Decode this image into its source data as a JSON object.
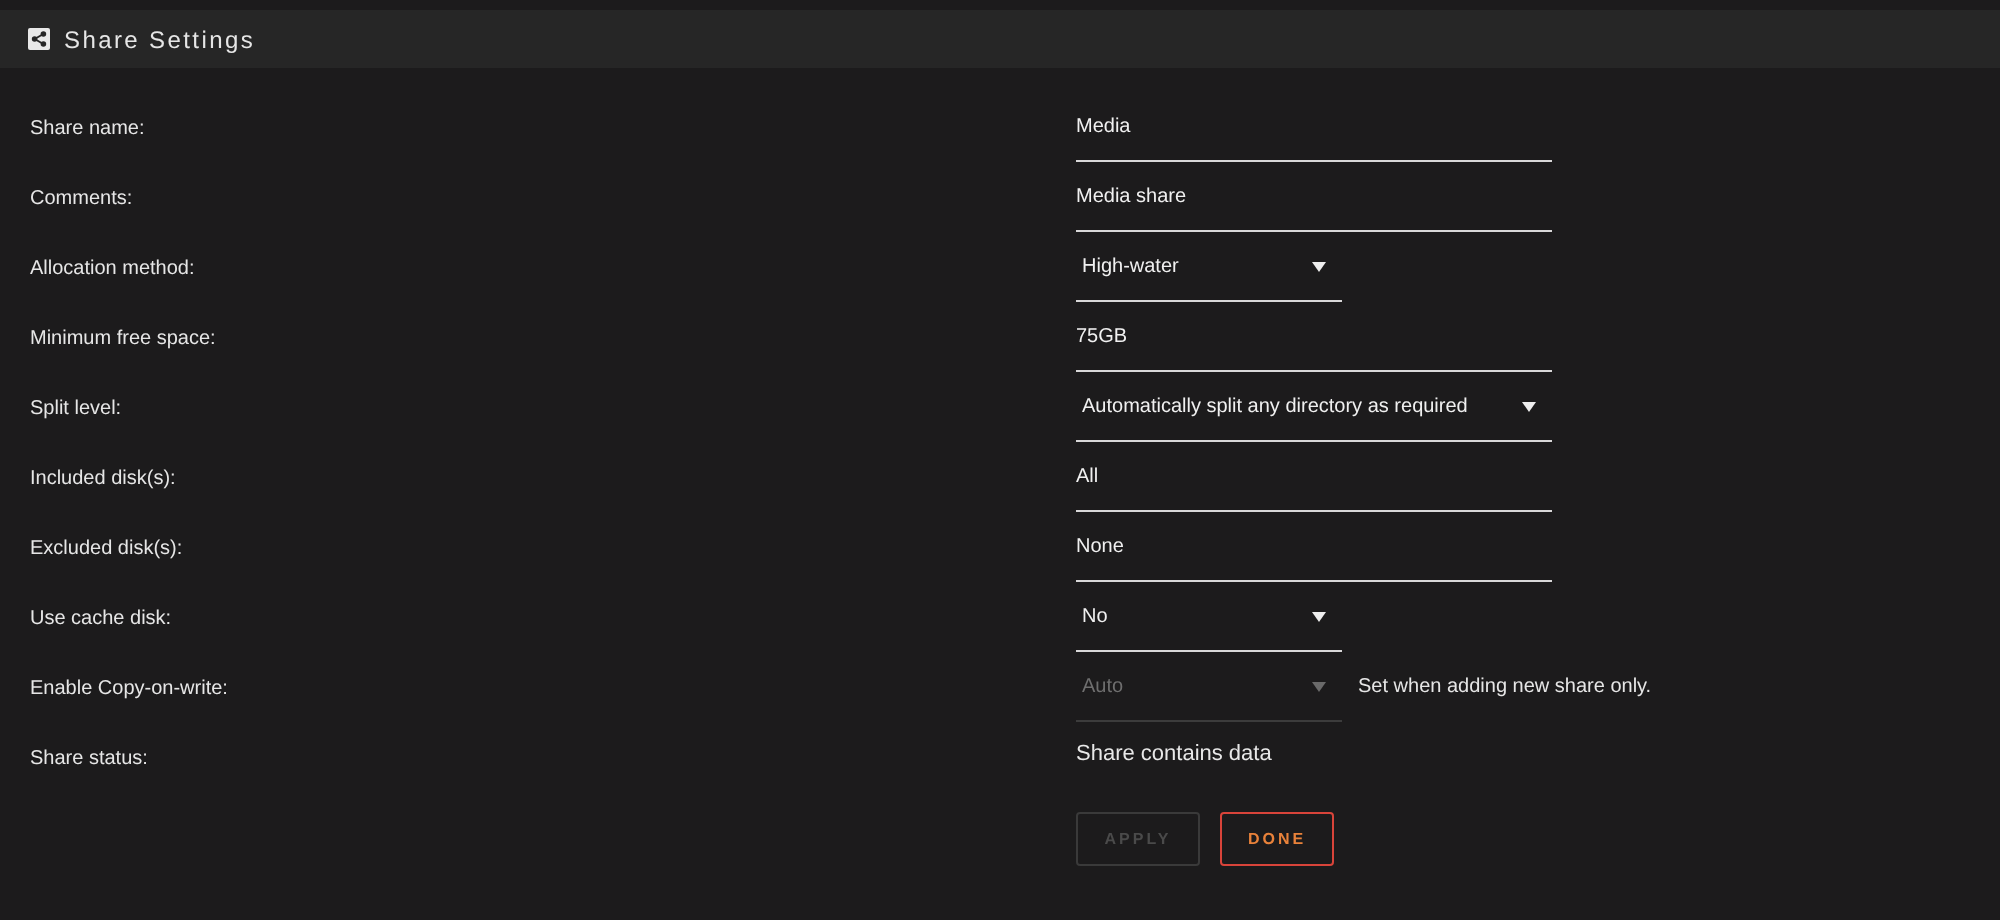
{
  "panel": {
    "title": "Share Settings"
  },
  "rows": [
    {
      "label": "Share name:",
      "kind": "text",
      "value": "Media"
    },
    {
      "label": "Comments:",
      "kind": "text",
      "value": "Media share"
    },
    {
      "label": "Allocation method:",
      "kind": "select",
      "value": "High-water",
      "disabled": false
    },
    {
      "label": "Minimum free space:",
      "kind": "text",
      "value": "75GB"
    },
    {
      "label": "Split level:",
      "kind": "longselect",
      "value": "Automatically split any directory as required",
      "disabled": false
    },
    {
      "label": "Included disk(s):",
      "kind": "text",
      "value": "All"
    },
    {
      "label": "Excluded disk(s):",
      "kind": "text",
      "value": "None"
    },
    {
      "label": "Use cache disk:",
      "kind": "select",
      "value": "No",
      "disabled": false
    },
    {
      "label": "Enable Copy-on-write:",
      "kind": "select",
      "value": "Auto",
      "disabled": true,
      "note": "Set when adding new share only."
    },
    {
      "label": "Share status:",
      "kind": "static",
      "value": "Share contains data"
    }
  ],
  "buttons": [
    {
      "label": "APPLY",
      "disabled": true
    },
    {
      "label": "DONE",
      "disabled": false
    }
  ]
}
